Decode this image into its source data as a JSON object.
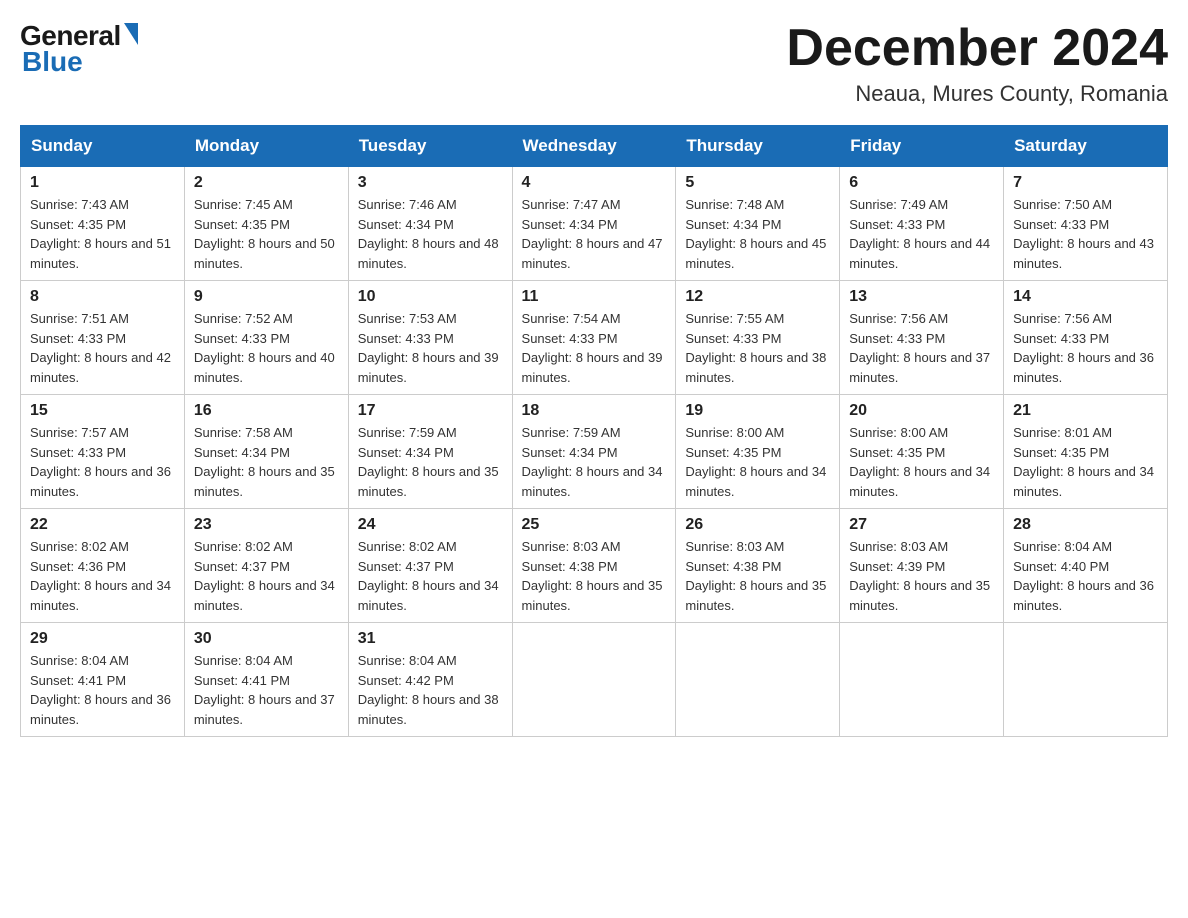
{
  "header": {
    "logo_general": "General",
    "logo_blue": "Blue",
    "month_title": "December 2024",
    "location": "Neaua, Mures County, Romania"
  },
  "days_of_week": [
    "Sunday",
    "Monday",
    "Tuesday",
    "Wednesday",
    "Thursday",
    "Friday",
    "Saturday"
  ],
  "weeks": [
    [
      {
        "day": "1",
        "sunrise": "7:43 AM",
        "sunset": "4:35 PM",
        "daylight": "8 hours and 51 minutes."
      },
      {
        "day": "2",
        "sunrise": "7:45 AM",
        "sunset": "4:35 PM",
        "daylight": "8 hours and 50 minutes."
      },
      {
        "day": "3",
        "sunrise": "7:46 AM",
        "sunset": "4:34 PM",
        "daylight": "8 hours and 48 minutes."
      },
      {
        "day": "4",
        "sunrise": "7:47 AM",
        "sunset": "4:34 PM",
        "daylight": "8 hours and 47 minutes."
      },
      {
        "day": "5",
        "sunrise": "7:48 AM",
        "sunset": "4:34 PM",
        "daylight": "8 hours and 45 minutes."
      },
      {
        "day": "6",
        "sunrise": "7:49 AM",
        "sunset": "4:33 PM",
        "daylight": "8 hours and 44 minutes."
      },
      {
        "day": "7",
        "sunrise": "7:50 AM",
        "sunset": "4:33 PM",
        "daylight": "8 hours and 43 minutes."
      }
    ],
    [
      {
        "day": "8",
        "sunrise": "7:51 AM",
        "sunset": "4:33 PM",
        "daylight": "8 hours and 42 minutes."
      },
      {
        "day": "9",
        "sunrise": "7:52 AM",
        "sunset": "4:33 PM",
        "daylight": "8 hours and 40 minutes."
      },
      {
        "day": "10",
        "sunrise": "7:53 AM",
        "sunset": "4:33 PM",
        "daylight": "8 hours and 39 minutes."
      },
      {
        "day": "11",
        "sunrise": "7:54 AM",
        "sunset": "4:33 PM",
        "daylight": "8 hours and 39 minutes."
      },
      {
        "day": "12",
        "sunrise": "7:55 AM",
        "sunset": "4:33 PM",
        "daylight": "8 hours and 38 minutes."
      },
      {
        "day": "13",
        "sunrise": "7:56 AM",
        "sunset": "4:33 PM",
        "daylight": "8 hours and 37 minutes."
      },
      {
        "day": "14",
        "sunrise": "7:56 AM",
        "sunset": "4:33 PM",
        "daylight": "8 hours and 36 minutes."
      }
    ],
    [
      {
        "day": "15",
        "sunrise": "7:57 AM",
        "sunset": "4:33 PM",
        "daylight": "8 hours and 36 minutes."
      },
      {
        "day": "16",
        "sunrise": "7:58 AM",
        "sunset": "4:34 PM",
        "daylight": "8 hours and 35 minutes."
      },
      {
        "day": "17",
        "sunrise": "7:59 AM",
        "sunset": "4:34 PM",
        "daylight": "8 hours and 35 minutes."
      },
      {
        "day": "18",
        "sunrise": "7:59 AM",
        "sunset": "4:34 PM",
        "daylight": "8 hours and 34 minutes."
      },
      {
        "day": "19",
        "sunrise": "8:00 AM",
        "sunset": "4:35 PM",
        "daylight": "8 hours and 34 minutes."
      },
      {
        "day": "20",
        "sunrise": "8:00 AM",
        "sunset": "4:35 PM",
        "daylight": "8 hours and 34 minutes."
      },
      {
        "day": "21",
        "sunrise": "8:01 AM",
        "sunset": "4:35 PM",
        "daylight": "8 hours and 34 minutes."
      }
    ],
    [
      {
        "day": "22",
        "sunrise": "8:02 AM",
        "sunset": "4:36 PM",
        "daylight": "8 hours and 34 minutes."
      },
      {
        "day": "23",
        "sunrise": "8:02 AM",
        "sunset": "4:37 PM",
        "daylight": "8 hours and 34 minutes."
      },
      {
        "day": "24",
        "sunrise": "8:02 AM",
        "sunset": "4:37 PM",
        "daylight": "8 hours and 34 minutes."
      },
      {
        "day": "25",
        "sunrise": "8:03 AM",
        "sunset": "4:38 PM",
        "daylight": "8 hours and 35 minutes."
      },
      {
        "day": "26",
        "sunrise": "8:03 AM",
        "sunset": "4:38 PM",
        "daylight": "8 hours and 35 minutes."
      },
      {
        "day": "27",
        "sunrise": "8:03 AM",
        "sunset": "4:39 PM",
        "daylight": "8 hours and 35 minutes."
      },
      {
        "day": "28",
        "sunrise": "8:04 AM",
        "sunset": "4:40 PM",
        "daylight": "8 hours and 36 minutes."
      }
    ],
    [
      {
        "day": "29",
        "sunrise": "8:04 AM",
        "sunset": "4:41 PM",
        "daylight": "8 hours and 36 minutes."
      },
      {
        "day": "30",
        "sunrise": "8:04 AM",
        "sunset": "4:41 PM",
        "daylight": "8 hours and 37 minutes."
      },
      {
        "day": "31",
        "sunrise": "8:04 AM",
        "sunset": "4:42 PM",
        "daylight": "8 hours and 38 minutes."
      },
      null,
      null,
      null,
      null
    ]
  ]
}
